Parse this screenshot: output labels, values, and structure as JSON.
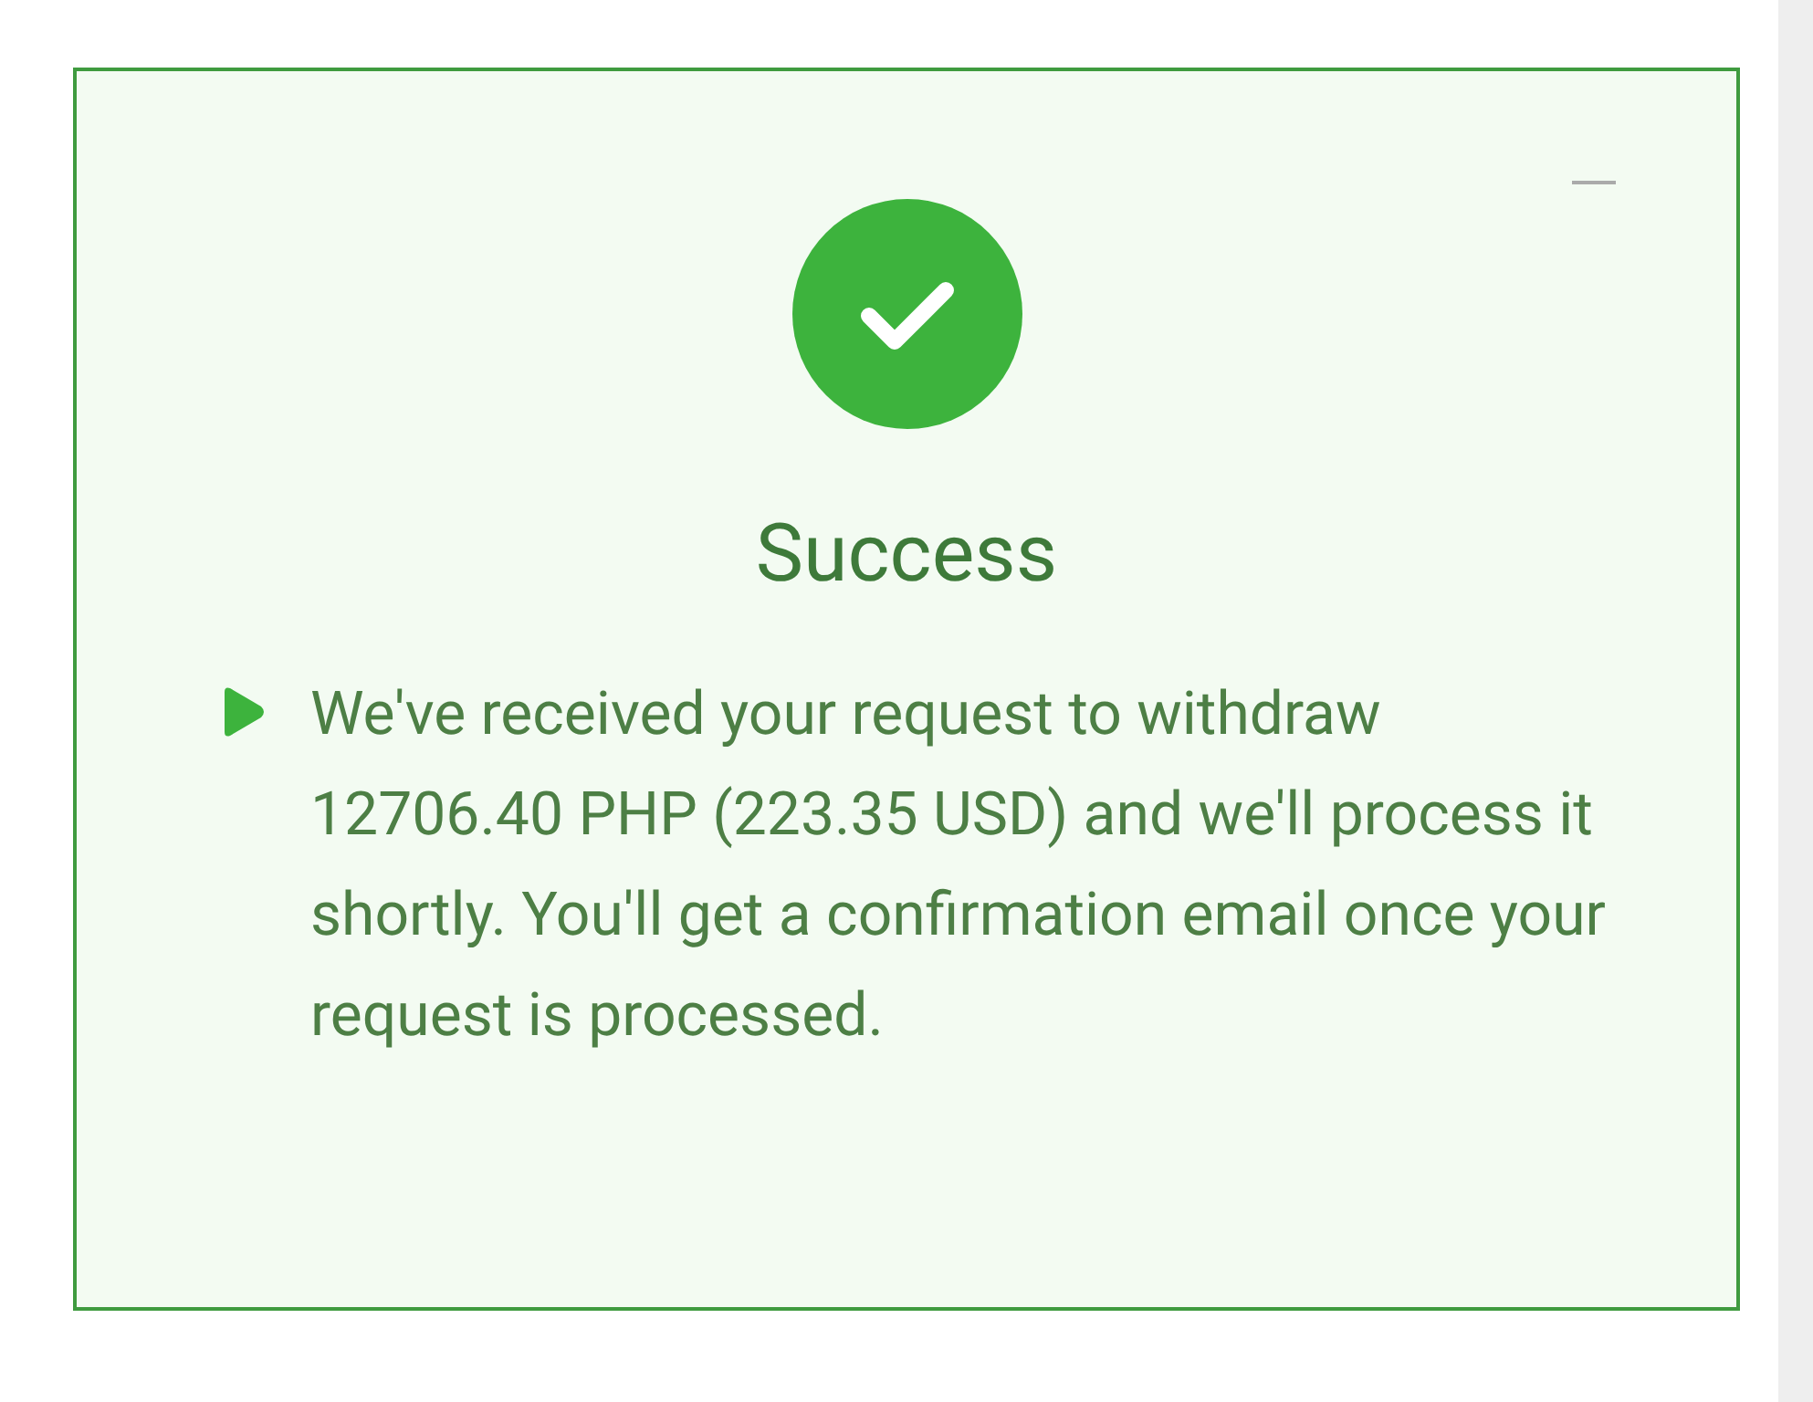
{
  "dialog": {
    "title": "Success",
    "message": "We've received your request to withdraw 12706.40 PHP (223.35 USD) and we'll process it shortly. You'll get a confirmation email once your request is processed."
  }
}
